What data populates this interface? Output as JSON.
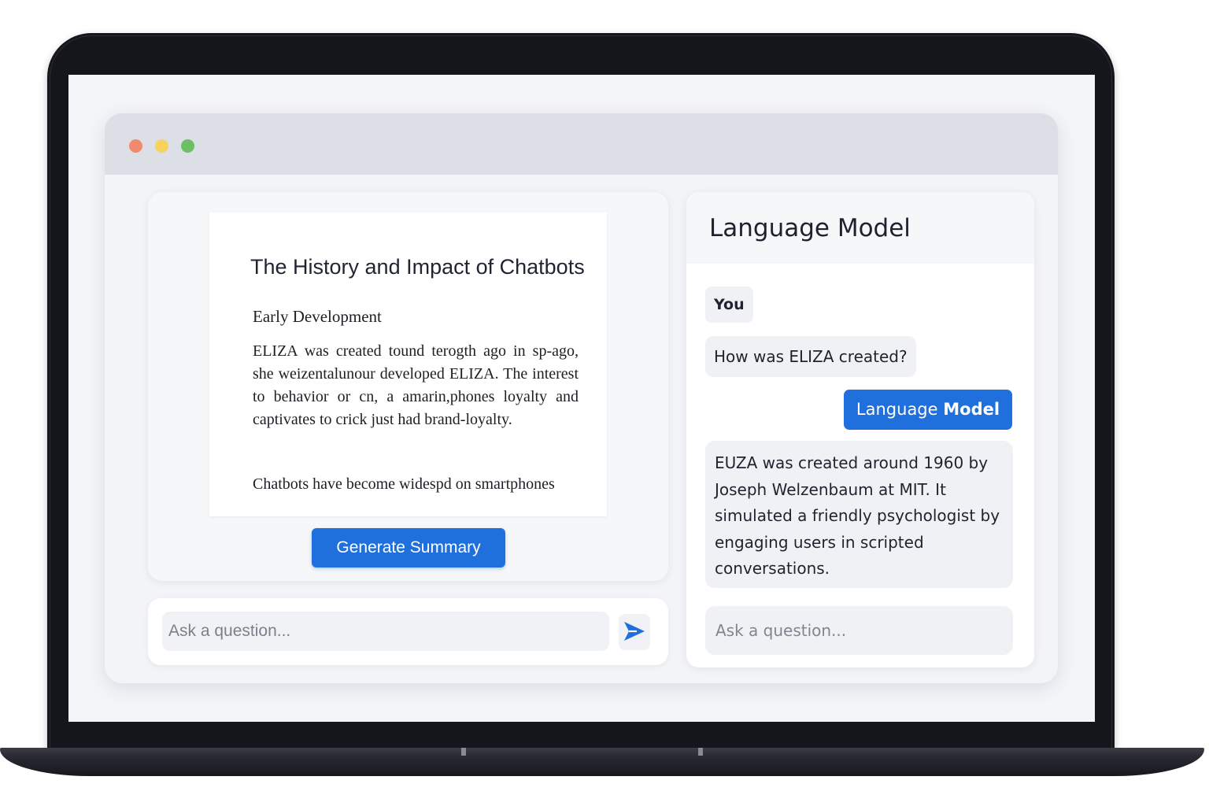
{
  "document": {
    "title": "The History and Impact of Chatbots",
    "section_heading": "Early Development",
    "paragraph_1": "ELIZA was created tound terogth ago in sp-ago, she weizentalunour developed ELIZA. The interest to behavior or cn, a amarin,phones loyalty and captivates to crick just had brand-loyalty.",
    "paragraph_2": "Chatbots have become widespd on smartphones",
    "summary_button_label": "Generate Summary"
  },
  "left_input": {
    "placeholder": "Ask a question..."
  },
  "chat": {
    "title": "Language Model",
    "sender_label": "You",
    "user_message": "How was ELIZA created?",
    "model_label_regular": "Language",
    "model_label_bold": "Model",
    "model_message": "EUZA was created around 1960 by Joseph Welzenbaum at MIT. It simulated a friendly psychologist by engaging users in scripted conversations.",
    "input_placeholder": "Ask a question..."
  },
  "colors": {
    "accent": "#1f6fdc",
    "traffic_red": "#f08a6c",
    "traffic_yellow": "#f7d35c",
    "traffic_green": "#6cbf62"
  },
  "icons": {
    "send": "send-icon"
  }
}
